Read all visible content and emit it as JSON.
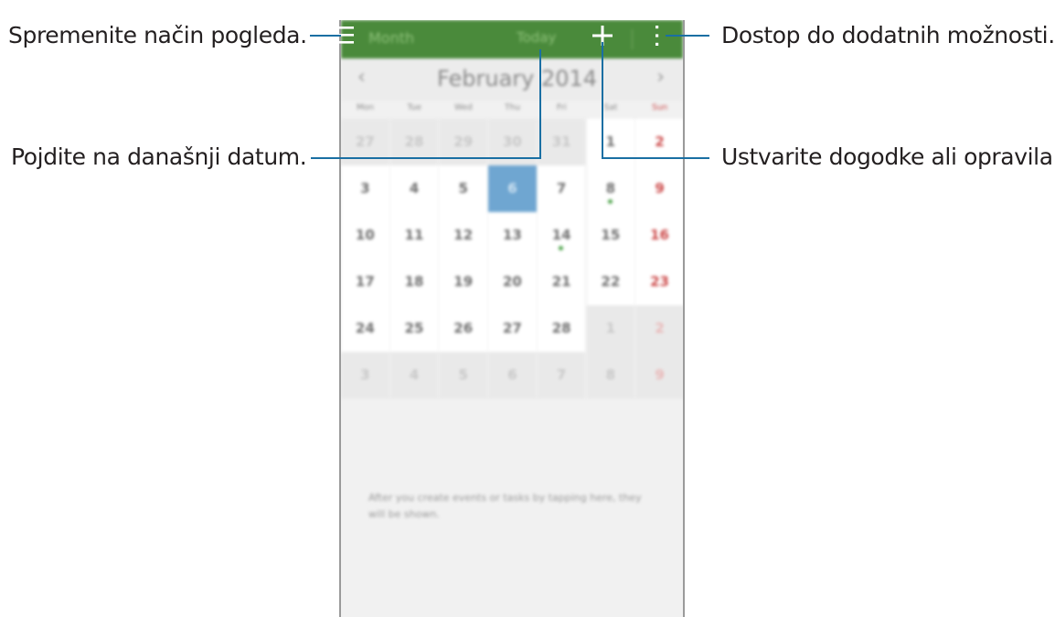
{
  "callouts": {
    "view_mode": "Spremenite način pogleda.",
    "today": "Pojdite na današnji datum.",
    "more_options": "Dostop do dodatnih možnosti.",
    "create": "Ustvarite dogodke ali opravila."
  },
  "action_bar": {
    "view_label": "Month",
    "today_label": "Today",
    "color": "#4a8a3b"
  },
  "calendar": {
    "prev_glyph": "‹",
    "next_glyph": "›",
    "month_title": "February 2014",
    "weekdays": [
      "Mon",
      "Tue",
      "Wed",
      "Thu",
      "Fri",
      "Sat",
      "Sun"
    ],
    "weeks": [
      [
        {
          "d": "27",
          "t": "other"
        },
        {
          "d": "28",
          "t": "other"
        },
        {
          "d": "29",
          "t": "other"
        },
        {
          "d": "30",
          "t": "other"
        },
        {
          "d": "31",
          "t": "other"
        },
        {
          "d": "1",
          "t": "cur"
        },
        {
          "d": "2",
          "t": "cur"
        }
      ],
      [
        {
          "d": "3",
          "t": "cur"
        },
        {
          "d": "4",
          "t": "cur"
        },
        {
          "d": "5",
          "t": "cur"
        },
        {
          "d": "6",
          "t": "today"
        },
        {
          "d": "7",
          "t": "cur"
        },
        {
          "d": "8",
          "t": "cur",
          "dot": true
        },
        {
          "d": "9",
          "t": "cur"
        }
      ],
      [
        {
          "d": "10",
          "t": "cur"
        },
        {
          "d": "11",
          "t": "cur"
        },
        {
          "d": "12",
          "t": "cur"
        },
        {
          "d": "13",
          "t": "cur"
        },
        {
          "d": "14",
          "t": "cur",
          "dot": true
        },
        {
          "d": "15",
          "t": "cur"
        },
        {
          "d": "16",
          "t": "cur"
        }
      ],
      [
        {
          "d": "17",
          "t": "cur"
        },
        {
          "d": "18",
          "t": "cur"
        },
        {
          "d": "19",
          "t": "cur"
        },
        {
          "d": "20",
          "t": "cur"
        },
        {
          "d": "21",
          "t": "cur"
        },
        {
          "d": "22",
          "t": "cur"
        },
        {
          "d": "23",
          "t": "cur"
        }
      ],
      [
        {
          "d": "24",
          "t": "cur"
        },
        {
          "d": "25",
          "t": "cur"
        },
        {
          "d": "26",
          "t": "cur"
        },
        {
          "d": "27",
          "t": "cur"
        },
        {
          "d": "28",
          "t": "cur"
        },
        {
          "d": "1",
          "t": "other"
        },
        {
          "d": "2",
          "t": "other"
        }
      ],
      [
        {
          "d": "3",
          "t": "other"
        },
        {
          "d": "4",
          "t": "other"
        },
        {
          "d": "5",
          "t": "other"
        },
        {
          "d": "6",
          "t": "other"
        },
        {
          "d": "7",
          "t": "other"
        },
        {
          "d": "8",
          "t": "other"
        },
        {
          "d": "9",
          "t": "other"
        }
      ]
    ],
    "empty_message": "After you create events or tasks by tapping here, they will be shown."
  },
  "icons": {
    "menu": "hamburger-menu-icon",
    "add": "plus-icon",
    "more": "overflow-menu-icon"
  }
}
